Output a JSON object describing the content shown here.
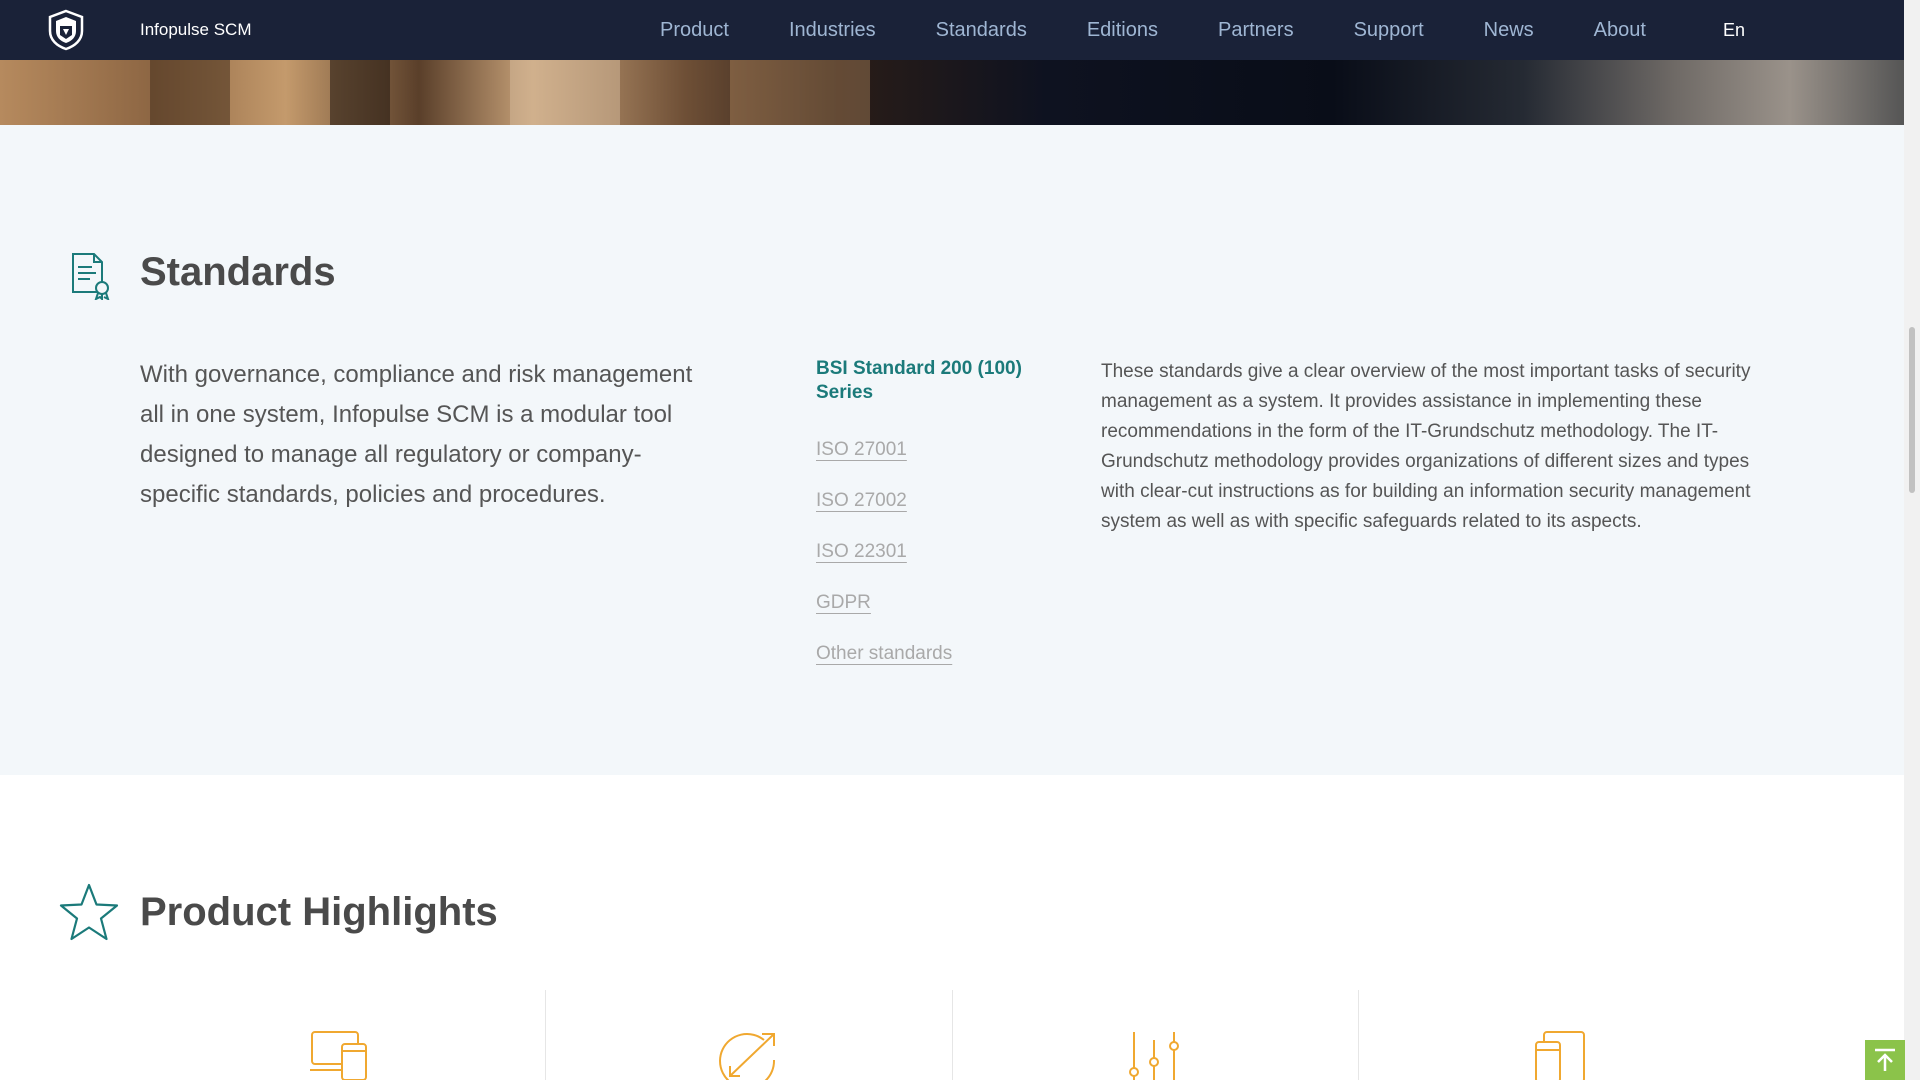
{
  "brand": {
    "name": "Infopulse SCM",
    "logo_icon": "shield-logo-icon"
  },
  "nav": {
    "items": [
      {
        "label": "Product"
      },
      {
        "label": "Industries"
      },
      {
        "label": "Standards"
      },
      {
        "label": "Editions"
      },
      {
        "label": "Partners"
      },
      {
        "label": "Support"
      },
      {
        "label": "News"
      },
      {
        "label": "About"
      }
    ],
    "language": "En"
  },
  "standards": {
    "icon": "certificate-document-icon",
    "title": "Standards",
    "intro": "With governance, compliance and risk management all in one system, Infopulse SCM is a modular tool designed to manage all regulatory or company-specific standards, policies and procedures.",
    "list": [
      {
        "label": "BSI Standard 200 (100) Series",
        "active": true
      },
      {
        "label": "ISO 27001",
        "active": false
      },
      {
        "label": "ISO 27002",
        "active": false
      },
      {
        "label": "ISO 22301",
        "active": false
      },
      {
        "label": "GDPR",
        "active": false
      },
      {
        "label": "Other standards",
        "active": false
      }
    ],
    "description": "These standards give a clear overview of the most important tasks of security management as a system. It provides assistance in implementing these recommendations in the form of the IT-Grundschutz methodology. The IT-Grundschutz methodology provides organizations of different sizes and types with clear-cut instructions as for building an information security management system as well as with specific safeguards related to its aspects."
  },
  "highlights": {
    "icon": "star-icon",
    "title": "Product Highlights",
    "items": [
      {
        "icon": "devices-icon"
      },
      {
        "icon": "growth-arrow-icon"
      },
      {
        "icon": "sliders-icon"
      },
      {
        "icon": "tablet-icon"
      }
    ]
  },
  "colors": {
    "nav_bg": "#1a2238",
    "nav_link": "#9fb6d3",
    "accent_teal": "#1b7a7a",
    "section_bg": "#f3f7fa",
    "icon_orange": "#f0a830",
    "to_top_green": "#8bc34a"
  }
}
